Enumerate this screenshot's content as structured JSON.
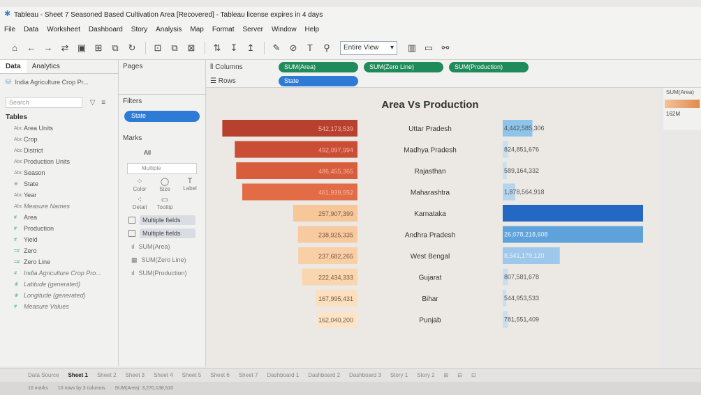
{
  "window": {
    "title": "Tableau - Sheet 7 Seasoned Based Cultivation Area [Recovered] - Tableau license expires in 4 days"
  },
  "menu": [
    "File",
    "Data",
    "Worksheet",
    "Dashboard",
    "Story",
    "Analysis",
    "Map",
    "Format",
    "Server",
    "Window",
    "Help"
  ],
  "toolbar": {
    "view_label": "Entire View"
  },
  "left_panel": {
    "tab_data": "Data",
    "tab_analytics": "Analytics",
    "datasource": "India Agriculture Crop Pr...",
    "search_placeholder": "Search",
    "tables_title": "Tables",
    "fields": [
      {
        "type": "Abc",
        "name": "Area Units",
        "kind": "dim"
      },
      {
        "type": "Abc",
        "name": "Crop",
        "kind": "dim"
      },
      {
        "type": "Abc",
        "name": "District",
        "kind": "dim"
      },
      {
        "type": "Abc",
        "name": "Production Units",
        "kind": "dim"
      },
      {
        "type": "Abc",
        "name": "Season",
        "kind": "dim"
      },
      {
        "type": "⊕",
        "name": "State",
        "kind": "dim"
      },
      {
        "type": "Abc",
        "name": "Year",
        "kind": "dim"
      },
      {
        "type": "Abc",
        "name": "Measure Names",
        "kind": "dim-it"
      },
      {
        "type": "#",
        "name": "Area",
        "kind": "mea"
      },
      {
        "type": "#",
        "name": "Production",
        "kind": "mea"
      },
      {
        "type": "#",
        "name": "Yield",
        "kind": "mea"
      },
      {
        "type": "=#",
        "name": "Zero",
        "kind": "mea"
      },
      {
        "type": "=#",
        "name": "Zero Line",
        "kind": "mea"
      },
      {
        "type": "#",
        "name": "India Agriculture Crop Pro...",
        "kind": "mea-it"
      },
      {
        "type": "⊕",
        "name": "Latitude (generated)",
        "kind": "mea-it"
      },
      {
        "type": "⊕",
        "name": "Longitude (generated)",
        "kind": "mea-it"
      },
      {
        "type": "#",
        "name": "Measure Values",
        "kind": "mea-it"
      }
    ]
  },
  "mid_panel": {
    "pages_label": "Pages",
    "filters_label": "Filters",
    "filter_pill": "State",
    "marks_label": "Marks",
    "marks_all": "All",
    "marks_type": "Multiple",
    "marks_cards": [
      {
        "icon": "⁘",
        "label": "Color"
      },
      {
        "icon": "◯",
        "label": "Size"
      },
      {
        "icon": "T",
        "label": "Label"
      },
      {
        "icon": "⁖",
        "label": "Detail"
      },
      {
        "icon": "▭",
        "label": "Tooltip"
      }
    ],
    "marks_fields": [
      "Multiple fields",
      "Multiple fields"
    ],
    "marks_list": [
      "SUM(Area)",
      "SUM(Zero Line)",
      "SUM(Production)"
    ]
  },
  "shelves": {
    "columns_label": "Columns",
    "rows_label": "Rows",
    "column_pills": [
      "SUM(Area)",
      "SUM(Zero Line)",
      "SUM(Production)"
    ],
    "row_pill": "State"
  },
  "right_strip": {
    "header": "SUM(Area)",
    "value": "162M"
  },
  "sheet_tabs": [
    "Data Source",
    "Sheet 1",
    "Sheet 2",
    "Sheet 3",
    "Sheet 4",
    "Sheet 5",
    "Sheet 6",
    "Sheet 7",
    "Dashboard 1",
    "Dashboard 2",
    "Dashboard 3",
    "Story 1",
    "Story 2"
  ],
  "status": [
    "10 marks",
    "10 rows by 3 columns",
    "SUM(Area): 3,270,138,510"
  ],
  "chart_data": {
    "type": "bar",
    "title": "Area Vs Production",
    "categories": [
      "Uttar Pradesh",
      "Madhya Pradesh",
      "Rajasthan",
      "Maharashtra",
      "Karnataka",
      "Andhra Pradesh",
      "West Bengal",
      "Gujarat",
      "Bihar",
      "Punjab"
    ],
    "series": [
      {
        "values": [
          542173539,
          492097994,
          486455365,
          461939552,
          257907399,
          238925335,
          237682265,
          222434333,
          167995431,
          162040200
        ],
        "labels": [
          "542,173,539",
          "492,097,994",
          "486,455,365",
          "461,939,552",
          "257,907,399",
          "238,925,335",
          "237,682,265",
          "222,434,333",
          "167,995,431",
          "162,040,200"
        ],
        "colors": [
          "#b8402f",
          "#c94e35",
          "#d85d3c",
          "#e26c45",
          "#f7c79a",
          "#f8caa0",
          "#f9cfa6",
          "#fad6b0",
          "#fbdfbf",
          "#fce4c8"
        ]
      },
      {
        "values": [
          4442585306,
          824851676,
          589164332,
          1878564918,
          21000000000,
          26078218608,
          8541179120,
          807581678,
          544953533,
          781551409
        ],
        "labels": [
          "4,442,585,306",
          "824,851,676",
          "589,164,332",
          "1,878,564,918",
          "",
          "26,078,218,608",
          "8,541,179,120",
          "807,581,678",
          "544,953,533",
          "781,551,409"
        ],
        "colors": [
          "#8ec3ea",
          "#c9dff1",
          "#c9dff1",
          "#b5d4ee",
          "#2468c4",
          "#5ea2dc",
          "#9dc8ec",
          "#c9dff1",
          "#c9dff1",
          "#c9dff1"
        ]
      }
    ]
  }
}
